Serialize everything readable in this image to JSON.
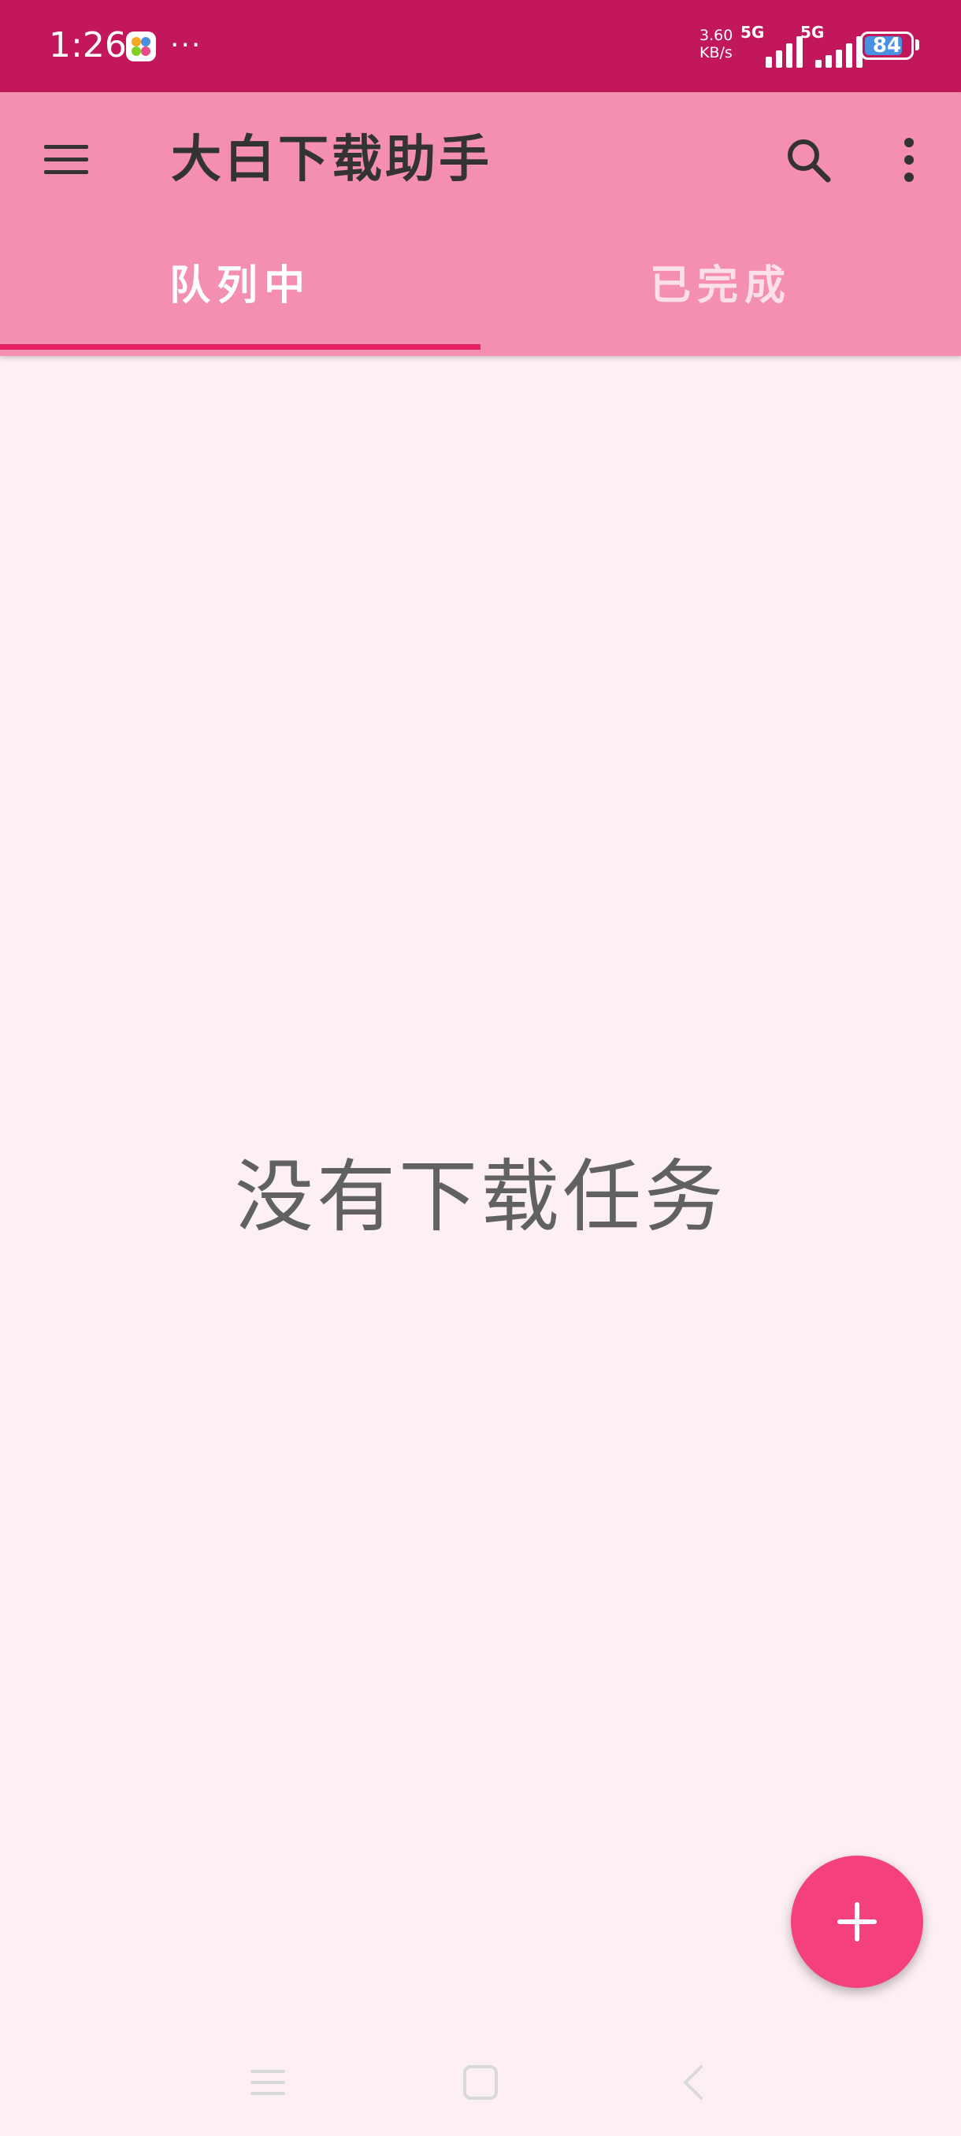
{
  "status_bar": {
    "time": "1:26",
    "more": "···",
    "speed_value": "3.60",
    "speed_unit": "KB/s",
    "sim1_network": "5G",
    "sim2_network": "5G",
    "battery_level": "84",
    "battery_percent": 84,
    "battery_color": "#4A90E2"
  },
  "app_bar": {
    "title": "大白下载助手",
    "menu_icon": "menu-icon",
    "search_icon": "search-icon",
    "more_icon": "more-vert-icon",
    "color": "#F48FB1"
  },
  "tabs": [
    {
      "label": "队列中",
      "selected": true
    },
    {
      "label": "已完成",
      "selected": false
    }
  ],
  "content": {
    "empty_message": "没有下载任务"
  },
  "fab": {
    "icon": "plus-icon",
    "color": "#F4407E"
  },
  "nav_bar": {
    "recents_icon": "recents-icon",
    "home_icon": "home-icon",
    "back_icon": "back-icon"
  }
}
